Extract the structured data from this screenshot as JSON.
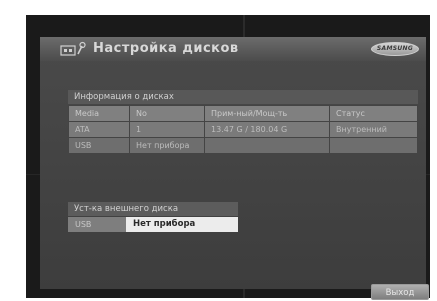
{
  "header": {
    "title": "Настройка дисков",
    "brand_logo": "SAMSUNG",
    "icon": "disk-settings-icon"
  },
  "disk_info": {
    "section_title": "Информация о дисках",
    "columns": [
      "Media",
      "No",
      "Прим-ный/Мощ-ть",
      "Статус"
    ],
    "rows": [
      [
        "ATA",
        "1",
        "13.47 G / 180.04 G",
        "Внутренний"
      ],
      [
        "USB",
        "Нет прибора",
        "",
        ""
      ]
    ]
  },
  "external_disk": {
    "section_title": "Уст-ка внешнего диска",
    "label": "USB",
    "value": "Нет прибора"
  },
  "footer": {
    "exit_label": "Выход"
  },
  "colors": {
    "background": "#1a1a1a",
    "panel": "#4a4a4a",
    "highlight": "#ececec"
  }
}
